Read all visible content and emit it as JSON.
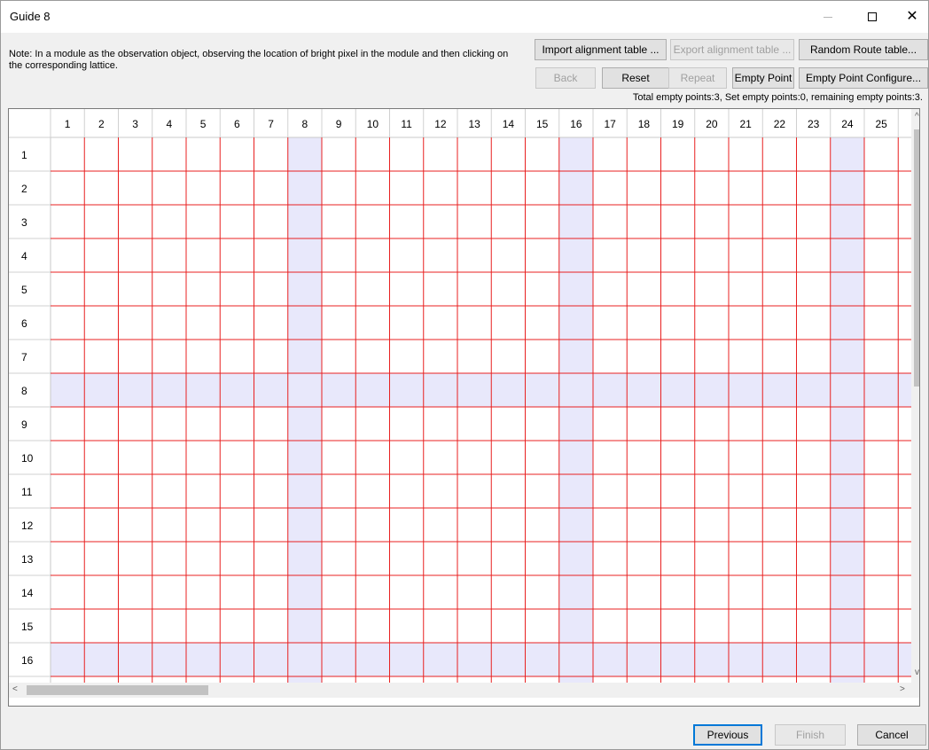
{
  "window": {
    "title": "Guide 8",
    "minimize": "—",
    "maximize": "☐",
    "close": "✕"
  },
  "note": "Note: In a module as the observation object, observing the location of bright pixel in the module and then clicking on the corresponding lattice.",
  "toolbar": {
    "import_label": "Import alignment table ...",
    "export_label": "Export alignment table ...",
    "random_route_label": "Random Route table...",
    "back_label": "Back",
    "reset_label": "Reset",
    "repeat_label": "Repeat",
    "empty_point_label": "Empty Point",
    "empty_point_config_label": "Empty Point Configure..."
  },
  "status": "Total empty points:3, Set empty points:0, remaining empty points:3.",
  "grid": {
    "columns": [
      "1",
      "2",
      "3",
      "4",
      "5",
      "6",
      "7",
      "8",
      "9",
      "10",
      "11",
      "12",
      "13",
      "14",
      "15",
      "16",
      "17",
      "18",
      "19",
      "20",
      "21",
      "22",
      "23",
      "24",
      "25"
    ],
    "rows": [
      "1",
      "2",
      "3",
      "4",
      "5",
      "6",
      "7",
      "8",
      "9",
      "10",
      "11",
      "12",
      "13",
      "14",
      "15",
      "16"
    ],
    "highlight_columns": [
      "8",
      "16",
      "24"
    ],
    "highlight_rows": [
      "8",
      "16"
    ],
    "line_color": "#e82020",
    "highlight_color": "#e8e8fb",
    "header_bg": "#ffffff"
  },
  "scroll": {
    "up_icon": "^",
    "down_icon": "v",
    "left_icon": "<",
    "right_icon": ">"
  },
  "footer": {
    "previous_label": "Previous",
    "finish_label": "Finish",
    "cancel_label": "Cancel"
  }
}
